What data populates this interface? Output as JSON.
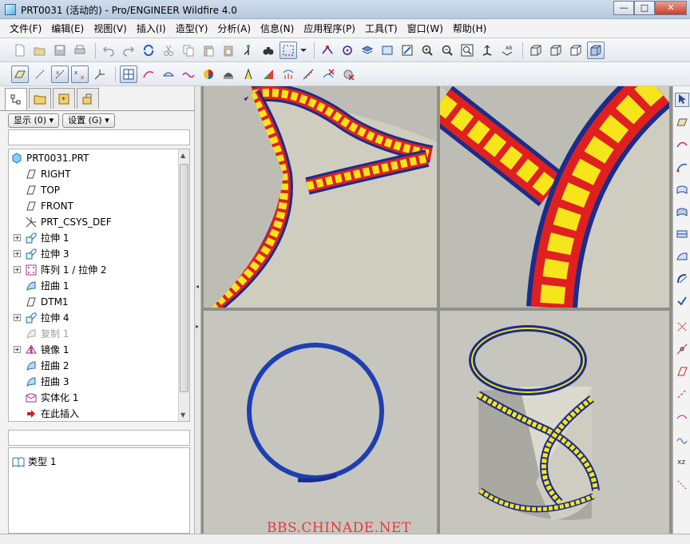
{
  "window": {
    "title": "PRT0031 (活动的) - Pro/ENGINEER Wildfire 4.0",
    "minimize": "—",
    "maximize": "□",
    "close": "✕"
  },
  "menu": [
    "文件(F)",
    "编辑(E)",
    "视图(V)",
    "插入(I)",
    "造型(Y)",
    "分析(A)",
    "信息(N)",
    "应用程序(P)",
    "工具(T)",
    "窗口(W)",
    "帮助(H)"
  ],
  "tree_panel": {
    "display_label": "显示 (0) ▾",
    "settings_label": "设置 (G) ▾",
    "items": [
      {
        "label": "PRT0031.PRT",
        "icon": "part-icon"
      },
      {
        "label": "RIGHT",
        "icon": "datum-plane-icon"
      },
      {
        "label": "TOP",
        "icon": "datum-plane-icon"
      },
      {
        "label": "FRONT",
        "icon": "datum-plane-icon"
      },
      {
        "label": "PRT_CSYS_DEF",
        "icon": "csys-icon"
      },
      {
        "label": "拉伸 1",
        "icon": "extrude-icon"
      },
      {
        "label": "拉伸 3",
        "icon": "extrude-icon"
      },
      {
        "label": "阵列 1 / 拉伸 2",
        "icon": "pattern-icon"
      },
      {
        "label": "扭曲 1",
        "icon": "warp-icon"
      },
      {
        "label": "DTM1",
        "icon": "datum-plane-icon"
      },
      {
        "label": "拉伸 4",
        "icon": "extrude-icon"
      },
      {
        "label": "复制 1",
        "icon": "copy-icon"
      },
      {
        "label": "镜像 1",
        "icon": "mirror-icon"
      },
      {
        "label": "扭曲 2",
        "icon": "warp-icon"
      },
      {
        "label": "扭曲 3",
        "icon": "warp-icon"
      },
      {
        "label": "实体化 1",
        "icon": "solidify-icon"
      },
      {
        "label": "在此插入",
        "icon": "insert-here-icon"
      }
    ],
    "type_item": "类型 1"
  },
  "watermark": "BBS.CHINADE.NET",
  "colors": {
    "rim": "#1a2d8a",
    "band_red": "#e02020",
    "band_yellow": "#f7e51c",
    "surface": "#dedcd0"
  }
}
